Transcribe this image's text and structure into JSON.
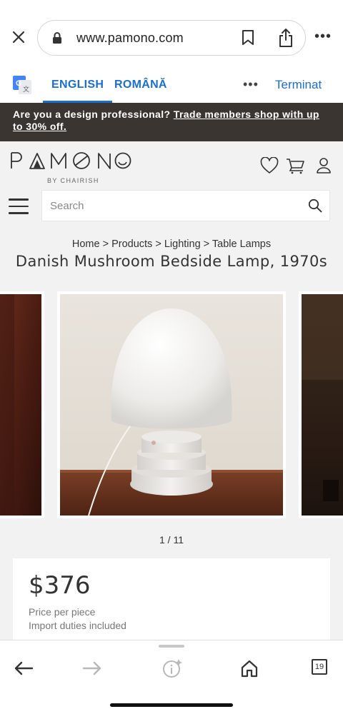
{
  "browser": {
    "url": "www.pamono.com",
    "icons": [
      "close-icon",
      "lock-icon",
      "bookmark-icon",
      "share-icon",
      "more-icon"
    ]
  },
  "translate": {
    "lang_active": "ENGLISH",
    "lang_other": "ROMÂNĂ",
    "more": "•••",
    "done": "Terminat"
  },
  "promo": {
    "text": "Are you a design professional? ",
    "link": "Trade members shop with up to 30% off."
  },
  "site": {
    "logo_text": "PAMONO",
    "logo_sub": "BY CHAIRISH",
    "search_placeholder": "Search"
  },
  "product": {
    "breadcrumb": [
      "Home",
      "Products",
      "Lighting",
      "Table Lamps"
    ],
    "breadcrumb_sep": " > ",
    "title": "Danish Mushroom Bedside Lamp, 1970s",
    "image_index": "1 / 11",
    "price": "$376",
    "price_note": "Price per piece",
    "duties_note": "Import duties included"
  },
  "toolbar": {
    "tabs_count": "19"
  },
  "colors": {
    "accent": "#1a6fd1",
    "banner_bg": "#3b3532",
    "page_bg": "#f2f2f2"
  }
}
